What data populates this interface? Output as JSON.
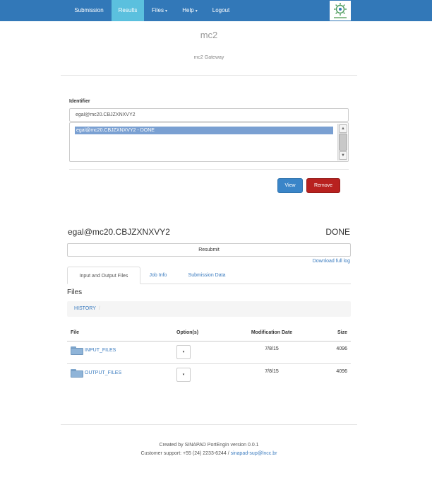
{
  "nav": {
    "items": [
      {
        "label": "Submission",
        "dropdown": false
      },
      {
        "label": "Results",
        "dropdown": false,
        "active": true
      },
      {
        "label": "Files",
        "dropdown": true
      },
      {
        "label": "Help",
        "dropdown": true
      },
      {
        "label": "Logout",
        "dropdown": false
      }
    ],
    "caret": "▾",
    "logo_icon": "sinapad-logo-icon",
    "color": "#3278b8",
    "active_color": "#5bc0de"
  },
  "header": {
    "title": "mc2",
    "subtitle": "mc2 Gateway"
  },
  "selector": {
    "label": "Identifier",
    "input_value": "egal@mc20.CBJZXNXVY2",
    "options": [
      "egal@mc20.CBJZXNXVY2 - DONE"
    ],
    "view_label": "View",
    "remove_label": "Remove"
  },
  "submission": {
    "id": "egal@mc20.CBJZXNXVY2",
    "status": "DONE",
    "resubmit_label": "Resubmit",
    "download_log_label": "Download full log",
    "tabs": [
      "Input and Output Files",
      "Job Info",
      "Submission Data"
    ],
    "active_tab": 0
  },
  "files": {
    "heading": "Files",
    "breadcrumb": [
      "HISTORY"
    ],
    "breadcrumb_sep": "/",
    "columns": [
      "File",
      "Option(s)",
      "Modification Date",
      "Size"
    ],
    "rows": [
      {
        "name": "INPUT_FILES",
        "date": "7/8/15",
        "size": "4096"
      },
      {
        "name": "OUTPUT_FILES",
        "date": "7/8/15",
        "size": "4096"
      }
    ],
    "option_glyph": "▾"
  },
  "footer": {
    "line1": "Created by SINAPAD PortEngin version 0.0.1",
    "line2_prefix": "Customer support: +55 (24) 2233-6244 / ",
    "email": "sinapad-sup@lncc.br"
  }
}
